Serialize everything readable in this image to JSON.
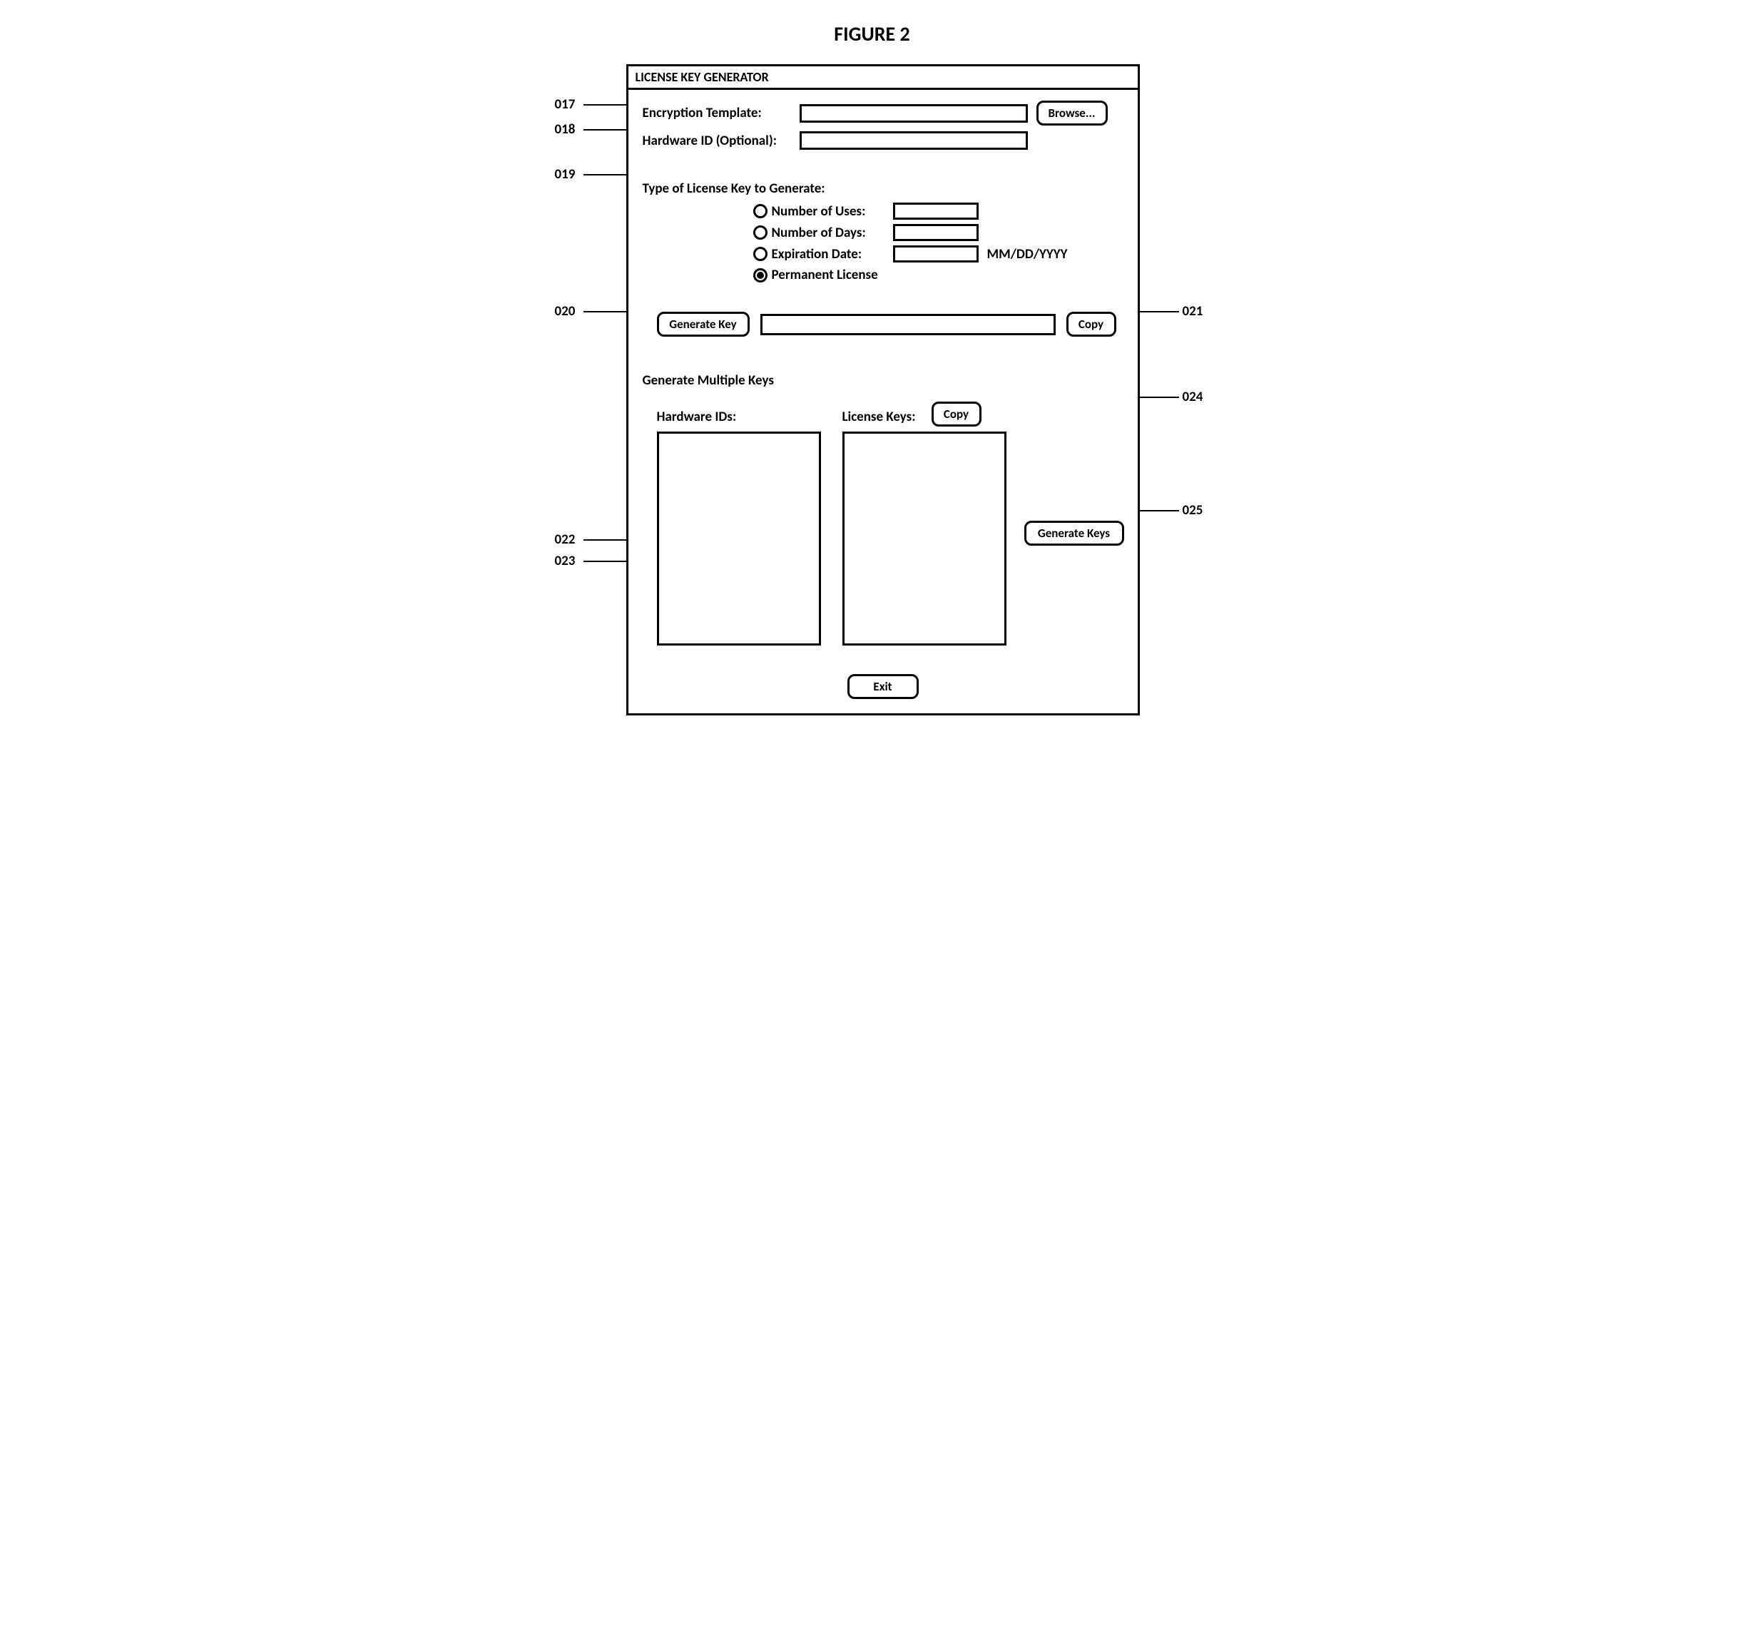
{
  "figure_title": "FIGURE 2",
  "window_title": "LICENSE KEY GENERATOR",
  "fields": {
    "encryption_template_label": "Encryption Template:",
    "hardware_id_label": "Hardware ID (Optional):",
    "browse_button": "Browse..."
  },
  "type_section": {
    "heading": "Type of License Key to Generate:",
    "options": {
      "uses": "Number of Uses:",
      "days": "Number of Days:",
      "expiration": "Expiration Date:",
      "permanent": "Permanent License"
    },
    "expiration_hint": "MM/DD/YYYY",
    "selected": "permanent"
  },
  "generate": {
    "generate_key_button": "Generate Key",
    "copy_button": "Copy"
  },
  "multi": {
    "heading": "Generate Multiple Keys",
    "hardware_ids_label": "Hardware IDs:",
    "license_keys_label": "License Keys:",
    "copy_button": "Copy",
    "generate_keys_button": "Generate Keys"
  },
  "exit_button": "Exit",
  "callouts": {
    "c017": "017",
    "c018": "018",
    "c019": "019",
    "c020": "020",
    "c021": "021",
    "c022": "022",
    "c023": "023",
    "c024": "024",
    "c025": "025"
  }
}
